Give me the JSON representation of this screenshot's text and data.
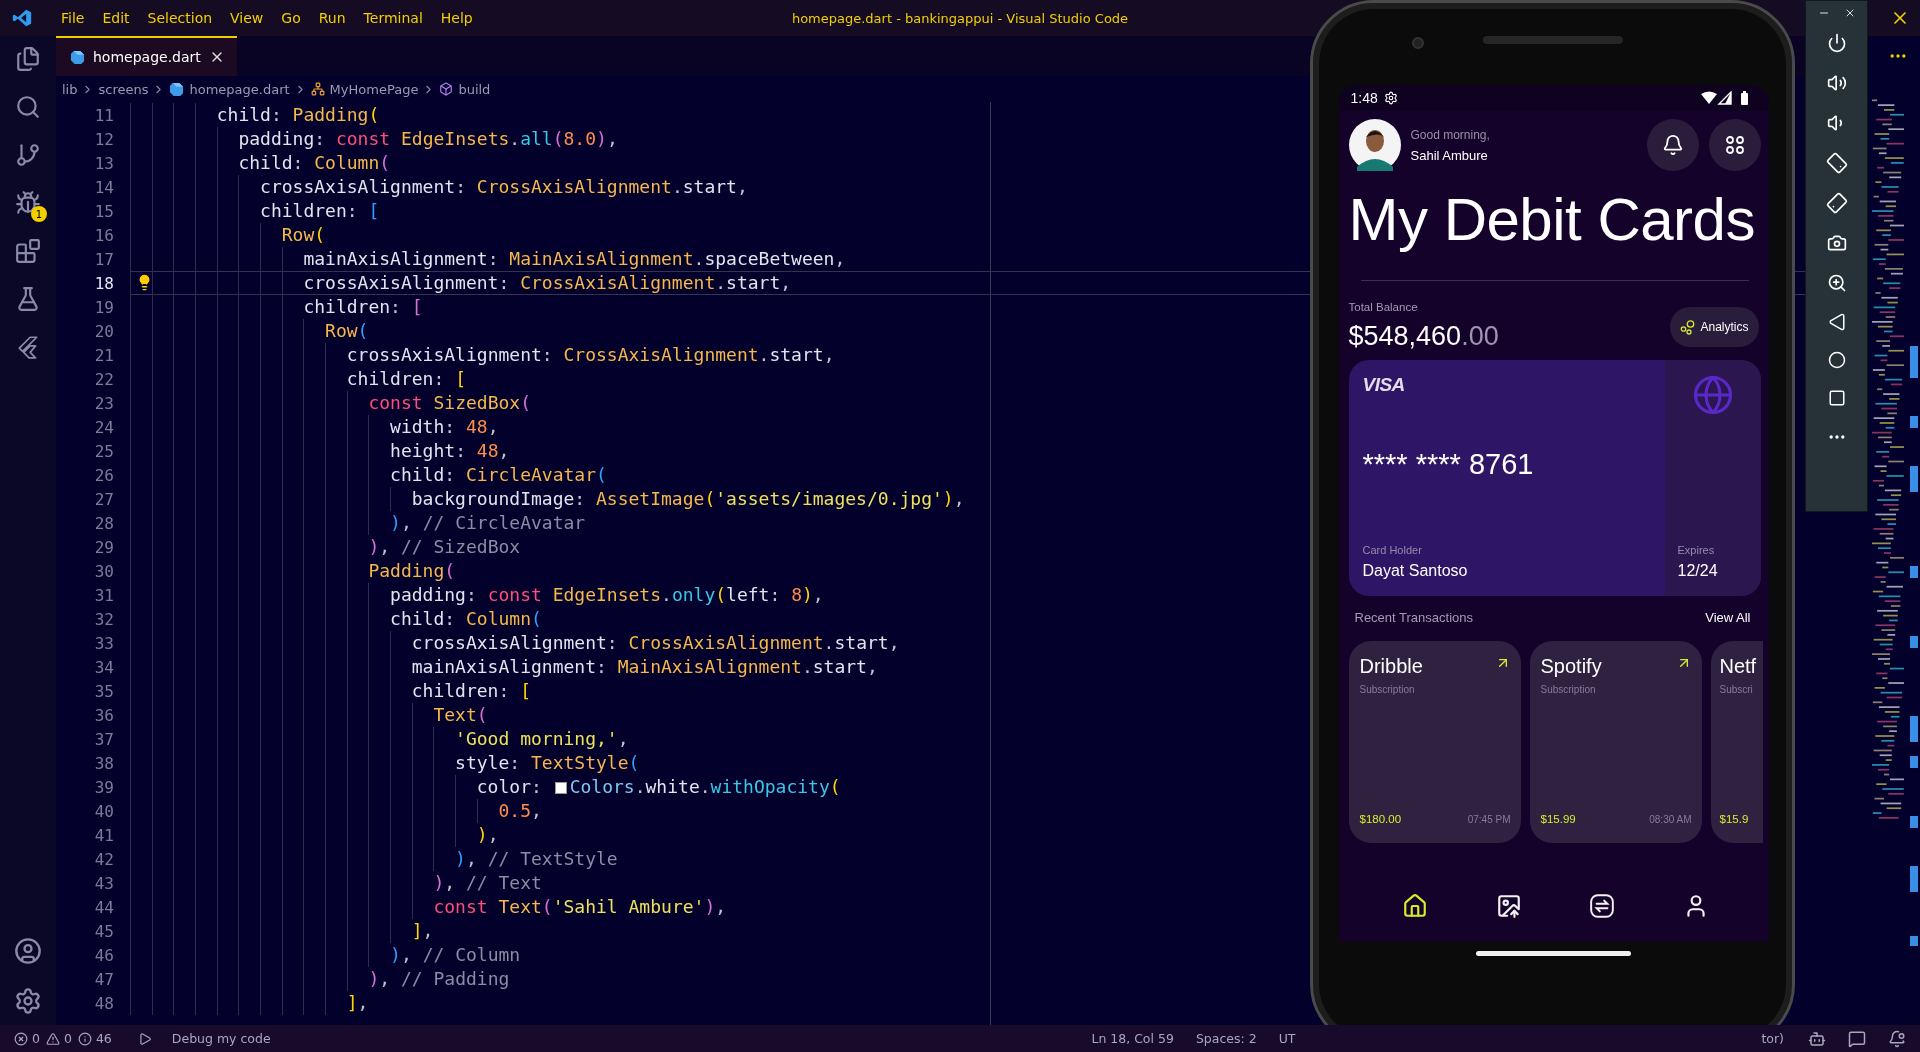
{
  "title_bar": {
    "menus": [
      "File",
      "Edit",
      "Selection",
      "View",
      "Go",
      "Run",
      "Terminal",
      "Help"
    ],
    "title": "homepage.dart - bankingappui - Visual Studio Code"
  },
  "activity_bar": {
    "debug_badge": "1"
  },
  "tab": {
    "label": "homepage.dart",
    "selected": true
  },
  "breadcrumbs": [
    {
      "label": "lib",
      "kind": "folder"
    },
    {
      "label": "screens",
      "kind": "folder"
    },
    {
      "label": "homepage.dart",
      "kind": "file"
    },
    {
      "label": "MyHomePage",
      "kind": "class"
    },
    {
      "label": "build",
      "kind": "method"
    }
  ],
  "editor": {
    "lines": [
      {
        "no": "11",
        "current": false,
        "tokens": [
          {
            "text": "        child",
            "kind": "property"
          },
          {
            "text": ": ",
            "kind": "punctuation"
          },
          {
            "text": "Padding",
            "kind": "type"
          },
          {
            "text": "(",
            "kind": "bracket1"
          }
        ]
      },
      {
        "no": "12",
        "current": false,
        "tokens": [
          {
            "text": "          padding",
            "kind": "property"
          },
          {
            "text": ": ",
            "kind": "punctuation"
          },
          {
            "text": "const ",
            "kind": "keyword"
          },
          {
            "text": "EdgeInsets",
            "kind": "type"
          },
          {
            "text": ".",
            "kind": "punctuation"
          },
          {
            "text": "all",
            "kind": "method"
          },
          {
            "text": "(",
            "kind": "bracket2"
          },
          {
            "text": "8.0",
            "kind": "number"
          },
          {
            "text": ")",
            "kind": "bracket2"
          },
          {
            "text": ",",
            "kind": "punctuation"
          }
        ]
      },
      {
        "no": "13",
        "current": false,
        "tokens": [
          {
            "text": "          child",
            "kind": "property"
          },
          {
            "text": ": ",
            "kind": "punctuation"
          },
          {
            "text": "Column",
            "kind": "type"
          },
          {
            "text": "(",
            "kind": "bracket2"
          }
        ]
      },
      {
        "no": "14",
        "current": false,
        "tokens": [
          {
            "text": "            crossAxisAlignment",
            "kind": "property"
          },
          {
            "text": ": ",
            "kind": "punctuation"
          },
          {
            "text": "CrossAxisAlignment",
            "kind": "type"
          },
          {
            "text": ".",
            "kind": "punctuation"
          },
          {
            "text": "start",
            "kind": "identifier"
          },
          {
            "text": ",",
            "kind": "punctuation"
          }
        ]
      },
      {
        "no": "15",
        "current": false,
        "tokens": [
          {
            "text": "            children",
            "kind": "property"
          },
          {
            "text": ": ",
            "kind": "punctuation"
          },
          {
            "text": "[",
            "kind": "bracket3"
          }
        ]
      },
      {
        "no": "16",
        "current": false,
        "tokens": [
          {
            "text": "              Row",
            "kind": "type"
          },
          {
            "text": "(",
            "kind": "bracket1"
          }
        ]
      },
      {
        "no": "17",
        "current": false,
        "tokens": [
          {
            "text": "                mainAxisAlignment",
            "kind": "property"
          },
          {
            "text": ": ",
            "kind": "punctuation"
          },
          {
            "text": "MainAxisAlignment",
            "kind": "type"
          },
          {
            "text": ".",
            "kind": "punctuation"
          },
          {
            "text": "spaceBetween",
            "kind": "identifier"
          },
          {
            "text": ",",
            "kind": "punctuation"
          }
        ]
      },
      {
        "no": "18",
        "current": true,
        "tokens": [
          {
            "text": "                crossAxisAlignment",
            "kind": "property"
          },
          {
            "text": ": ",
            "kind": "punctuation"
          },
          {
            "text": "CrossAxisAlignment",
            "kind": "type"
          },
          {
            "text": ".",
            "kind": "punctuation"
          },
          {
            "text": "start",
            "kind": "identifier"
          },
          {
            "text": ",",
            "kind": "punctuation"
          }
        ]
      },
      {
        "no": "19",
        "current": false,
        "tokens": [
          {
            "text": "                children",
            "kind": "property"
          },
          {
            "text": ": ",
            "kind": "punctuation"
          },
          {
            "text": "[",
            "kind": "bracket2"
          }
        ]
      },
      {
        "no": "20",
        "current": false,
        "tokens": [
          {
            "text": "                  Row",
            "kind": "type"
          },
          {
            "text": "(",
            "kind": "bracket3"
          }
        ]
      },
      {
        "no": "21",
        "current": false,
        "tokens": [
          {
            "text": "                    crossAxisAlignment",
            "kind": "property"
          },
          {
            "text": ": ",
            "kind": "punctuation"
          },
          {
            "text": "CrossAxisAlignment",
            "kind": "type"
          },
          {
            "text": ".",
            "kind": "punctuation"
          },
          {
            "text": "start",
            "kind": "identifier"
          },
          {
            "text": ",",
            "kind": "punctuation"
          }
        ]
      },
      {
        "no": "22",
        "current": false,
        "tokens": [
          {
            "text": "                    children",
            "kind": "property"
          },
          {
            "text": ": ",
            "kind": "punctuation"
          },
          {
            "text": "[",
            "kind": "bracket1"
          }
        ]
      },
      {
        "no": "23",
        "current": false,
        "tokens": [
          {
            "text": "                      const ",
            "kind": "keyword"
          },
          {
            "text": "SizedBox",
            "kind": "type"
          },
          {
            "text": "(",
            "kind": "bracket2"
          }
        ]
      },
      {
        "no": "24",
        "current": false,
        "tokens": [
          {
            "text": "                        width",
            "kind": "property"
          },
          {
            "text": ": ",
            "kind": "punctuation"
          },
          {
            "text": "48",
            "kind": "number"
          },
          {
            "text": ",",
            "kind": "punctuation"
          }
        ]
      },
      {
        "no": "25",
        "current": false,
        "tokens": [
          {
            "text": "                        height",
            "kind": "property"
          },
          {
            "text": ": ",
            "kind": "punctuation"
          },
          {
            "text": "48",
            "kind": "number"
          },
          {
            "text": ",",
            "kind": "punctuation"
          }
        ]
      },
      {
        "no": "26",
        "current": false,
        "tokens": [
          {
            "text": "                        child",
            "kind": "property"
          },
          {
            "text": ": ",
            "kind": "punctuation"
          },
          {
            "text": "CircleAvatar",
            "kind": "type"
          },
          {
            "text": "(",
            "kind": "bracket3"
          }
        ]
      },
      {
        "no": "27",
        "current": false,
        "tokens": [
          {
            "text": "                          backgroundImage",
            "kind": "property"
          },
          {
            "text": ": ",
            "kind": "punctuation"
          },
          {
            "text": "AssetImage",
            "kind": "type"
          },
          {
            "text": "(",
            "kind": "bracket1"
          },
          {
            "text": "'assets/images/0.jpg'",
            "kind": "string"
          },
          {
            "text": ")",
            "kind": "bracket1"
          },
          {
            "text": ",",
            "kind": "punctuation"
          }
        ]
      },
      {
        "no": "28",
        "current": false,
        "tokens": [
          {
            "text": "                        )",
            "kind": "bracket3"
          },
          {
            "text": ", ",
            "kind": "punctuation"
          },
          {
            "text": "// CircleAvatar",
            "kind": "comment"
          }
        ]
      },
      {
        "no": "29",
        "current": false,
        "tokens": [
          {
            "text": "                      )",
            "kind": "bracket2"
          },
          {
            "text": ", ",
            "kind": "punctuation"
          },
          {
            "text": "// SizedBox",
            "kind": "comment"
          }
        ]
      },
      {
        "no": "30",
        "current": false,
        "tokens": [
          {
            "text": "                      Padding",
            "kind": "type"
          },
          {
            "text": "(",
            "kind": "bracket2"
          }
        ]
      },
      {
        "no": "31",
        "current": false,
        "tokens": [
          {
            "text": "                        padding",
            "kind": "property"
          },
          {
            "text": ": ",
            "kind": "punctuation"
          },
          {
            "text": "const ",
            "kind": "keyword"
          },
          {
            "text": "EdgeInsets",
            "kind": "type"
          },
          {
            "text": ".",
            "kind": "punctuation"
          },
          {
            "text": "only",
            "kind": "method"
          },
          {
            "text": "(",
            "kind": "bracket1"
          },
          {
            "text": "left",
            "kind": "property"
          },
          {
            "text": ": ",
            "kind": "punctuation"
          },
          {
            "text": "8",
            "kind": "number"
          },
          {
            "text": ")",
            "kind": "bracket1"
          },
          {
            "text": ",",
            "kind": "punctuation"
          }
        ]
      },
      {
        "no": "32",
        "current": false,
        "tokens": [
          {
            "text": "                        child",
            "kind": "property"
          },
          {
            "text": ": ",
            "kind": "punctuation"
          },
          {
            "text": "Column",
            "kind": "type"
          },
          {
            "text": "(",
            "kind": "bracket3"
          }
        ]
      },
      {
        "no": "33",
        "current": false,
        "tokens": [
          {
            "text": "                          crossAxisAlignment",
            "kind": "property"
          },
          {
            "text": ": ",
            "kind": "punctuation"
          },
          {
            "text": "CrossAxisAlignment",
            "kind": "type"
          },
          {
            "text": ".",
            "kind": "punctuation"
          },
          {
            "text": "start",
            "kind": "identifier"
          },
          {
            "text": ",",
            "kind": "punctuation"
          }
        ]
      },
      {
        "no": "34",
        "current": false,
        "tokens": [
          {
            "text": "                          mainAxisAlignment",
            "kind": "property"
          },
          {
            "text": ": ",
            "kind": "punctuation"
          },
          {
            "text": "MainAxisAlignment",
            "kind": "type"
          },
          {
            "text": ".",
            "kind": "punctuation"
          },
          {
            "text": "start",
            "kind": "identifier"
          },
          {
            "text": ",",
            "kind": "punctuation"
          }
        ]
      },
      {
        "no": "35",
        "current": false,
        "tokens": [
          {
            "text": "                          children",
            "kind": "property"
          },
          {
            "text": ": ",
            "kind": "punctuation"
          },
          {
            "text": "[",
            "kind": "bracket1"
          }
        ]
      },
      {
        "no": "36",
        "current": false,
        "tokens": [
          {
            "text": "                            Text",
            "kind": "type"
          },
          {
            "text": "(",
            "kind": "bracket2"
          }
        ]
      },
      {
        "no": "37",
        "current": false,
        "tokens": [
          {
            "text": "                              'Good morning,'",
            "kind": "string"
          },
          {
            "text": ",",
            "kind": "punctuation"
          }
        ]
      },
      {
        "no": "38",
        "current": false,
        "tokens": [
          {
            "text": "                              style",
            "kind": "property"
          },
          {
            "text": ": ",
            "kind": "punctuation"
          },
          {
            "text": "TextStyle",
            "kind": "type"
          },
          {
            "text": "(",
            "kind": "bracket3"
          }
        ]
      },
      {
        "no": "39",
        "current": false,
        "tokens": [
          {
            "text": "                                color",
            "kind": "property"
          },
          {
            "text": ": ",
            "kind": "punctuation"
          },
          {
            "text": "Colors",
            "kind": "swatch"
          },
          {
            "text": ".",
            "kind": "punctuation"
          },
          {
            "text": "white",
            "kind": "identifier"
          },
          {
            "text": ".",
            "kind": "punctuation"
          },
          {
            "text": "withOpacity",
            "kind": "method"
          },
          {
            "text": "(",
            "kind": "bracket1"
          }
        ]
      },
      {
        "no": "40",
        "current": false,
        "tokens": [
          {
            "text": "                                  0.5",
            "kind": "number"
          },
          {
            "text": ",",
            "kind": "punctuation"
          }
        ]
      },
      {
        "no": "41",
        "current": false,
        "tokens": [
          {
            "text": "                                )",
            "kind": "bracket1"
          },
          {
            "text": ",",
            "kind": "punctuation"
          }
        ]
      },
      {
        "no": "42",
        "current": false,
        "tokens": [
          {
            "text": "                              )",
            "kind": "bracket3"
          },
          {
            "text": ", ",
            "kind": "punctuation"
          },
          {
            "text": "// TextStyle",
            "kind": "comment"
          }
        ]
      },
      {
        "no": "43",
        "current": false,
        "tokens": [
          {
            "text": "                            )",
            "kind": "bracket2"
          },
          {
            "text": ", ",
            "kind": "punctuation"
          },
          {
            "text": "// Text",
            "kind": "comment"
          }
        ]
      },
      {
        "no": "44",
        "current": false,
        "tokens": [
          {
            "text": "                            const ",
            "kind": "keyword"
          },
          {
            "text": "Text",
            "kind": "type"
          },
          {
            "text": "(",
            "kind": "bracket2"
          },
          {
            "text": "'Sahil Ambure'",
            "kind": "string"
          },
          {
            "text": ")",
            "kind": "bracket2"
          },
          {
            "text": ",",
            "kind": "punctuation"
          }
        ]
      },
      {
        "no": "45",
        "current": false,
        "tokens": [
          {
            "text": "                          ]",
            "kind": "bracket1"
          },
          {
            "text": ",",
            "kind": "punctuation"
          }
        ]
      },
      {
        "no": "46",
        "current": false,
        "tokens": [
          {
            "text": "                        )",
            "kind": "bracket3"
          },
          {
            "text": ", ",
            "kind": "punctuation"
          },
          {
            "text": "// Column",
            "kind": "comment"
          }
        ]
      },
      {
        "no": "47",
        "current": false,
        "tokens": [
          {
            "text": "                      )",
            "kind": "bracket2"
          },
          {
            "text": ", ",
            "kind": "punctuation"
          },
          {
            "text": "// Padding",
            "kind": "comment"
          }
        ]
      },
      {
        "no": "48",
        "current": false,
        "tokens": [
          {
            "text": "                    ]",
            "kind": "bracket1"
          },
          {
            "text": ",",
            "kind": "punctuation"
          }
        ]
      }
    ]
  },
  "status_bar": {
    "errors": "0",
    "warnings": "0",
    "infos": "46",
    "debug": "Debug my code",
    "position": "Ln 18, Col 59",
    "spaces": "Spaces: 2",
    "encoding": "UT",
    "mode": "tor)"
  },
  "phone": {
    "time": "1:48",
    "greeting": "Good morning,",
    "user": "Sahil Ambure",
    "title": "My Debit Cards",
    "balance_label": "Total Balance",
    "balance_main": "$548,460",
    "balance_cents": ".00",
    "analytics": "Analytics",
    "card": {
      "brand": "VISA",
      "number": "**** **** 8761",
      "holder_label": "Card Holder",
      "holder": "Dayat Santoso",
      "expires_label": "Expires",
      "expires": "12/24"
    },
    "recent_title": "Recent Transactions",
    "view_all": "View All",
    "transactions": [
      {
        "kind": "full",
        "name": "Dribble",
        "type": "Subscription",
        "amount": "$180.00",
        "time": "07:45 PM"
      },
      {
        "kind": "full",
        "name": "Spotify",
        "type": "Subscription",
        "amount": "$15.99",
        "time": "08:30 AM"
      },
      {
        "kind": "cut",
        "name": "Netf",
        "type": "Subscri",
        "amount": "$15.9"
      }
    ],
    "nav": [
      {
        "kind": "home",
        "selected": true
      },
      {
        "kind": "gallery",
        "selected": false
      },
      {
        "kind": "transfer",
        "selected": false
      },
      {
        "kind": "profile",
        "selected": false
      }
    ]
  }
}
